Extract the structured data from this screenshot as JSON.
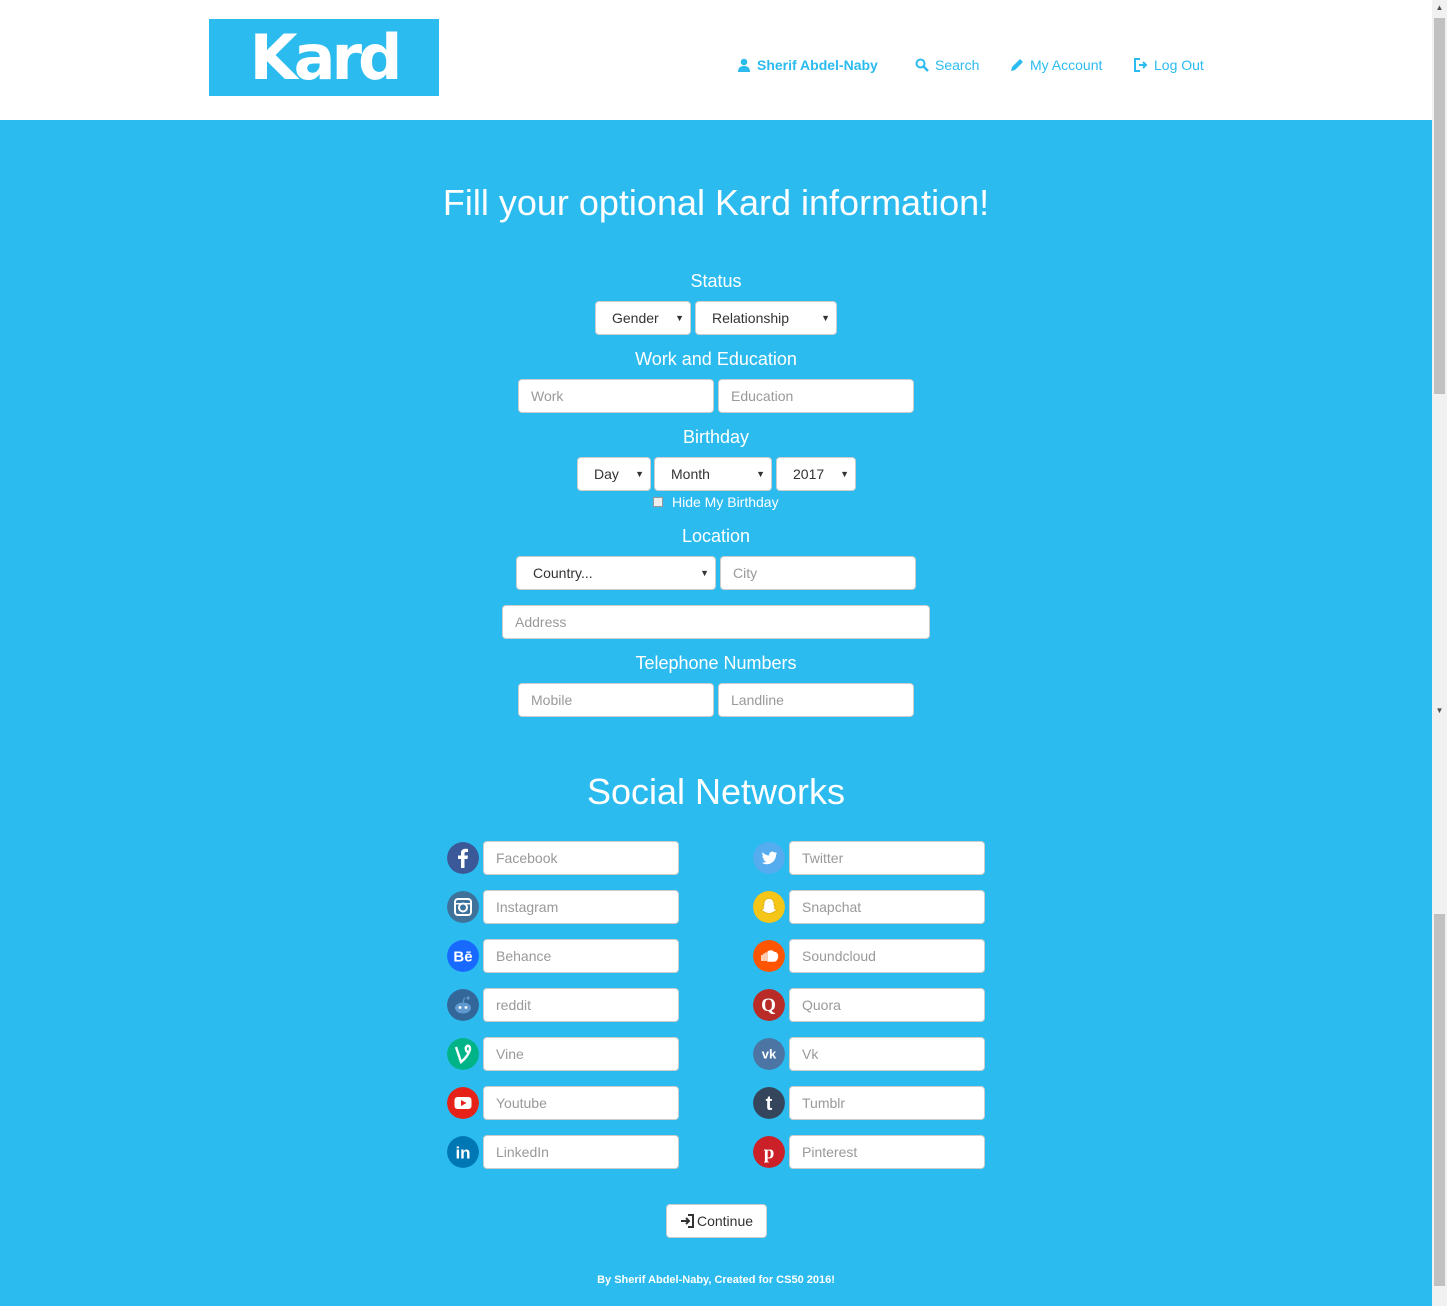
{
  "header": {
    "logo_text": "Kard",
    "nav": {
      "user_name": "Sherif Abdel-Naby",
      "search": "Search",
      "my_account": "My Account",
      "log_out": "Log Out"
    }
  },
  "page": {
    "title": "Fill your optional Kard information!",
    "status": {
      "heading": "Status",
      "gender_value": "Gender",
      "relationship_value": "Relationship"
    },
    "work_education": {
      "heading": "Work and Education",
      "work_placeholder": "Work",
      "education_placeholder": "Education"
    },
    "birthday": {
      "heading": "Birthday",
      "day_value": "Day",
      "month_value": "Month",
      "year_value": "2017",
      "hide_label": "Hide My Birthday",
      "hide_checked": false
    },
    "location": {
      "heading": "Location",
      "country_value": "Country...",
      "city_placeholder": "City",
      "address_placeholder": "Address"
    },
    "telephone": {
      "heading": "Telephone Numbers",
      "mobile_placeholder": "Mobile",
      "landline_placeholder": "Landline"
    },
    "social": {
      "heading": "Social Networks",
      "left": [
        {
          "name": "Facebook",
          "icon": "facebook-icon",
          "color": "#3b5998"
        },
        {
          "name": "Instagram",
          "icon": "instagram-icon",
          "color": "#3f729b"
        },
        {
          "name": "Behance",
          "icon": "behance-icon",
          "color": "#1769ff"
        },
        {
          "name": "reddit",
          "icon": "reddit-icon",
          "color": "#336699"
        },
        {
          "name": "Vine",
          "icon": "vine-icon",
          "color": "#00b488"
        },
        {
          "name": "Youtube",
          "icon": "youtube-icon",
          "color": "#e62117"
        },
        {
          "name": "LinkedIn",
          "icon": "linkedin-icon",
          "color": "#0077b5"
        }
      ],
      "right": [
        {
          "name": "Twitter",
          "icon": "twitter-icon",
          "color": "#55acee"
        },
        {
          "name": "Snapchat",
          "icon": "snapchat-icon",
          "color": "#fffc00"
        },
        {
          "name": "Soundcloud",
          "icon": "soundcloud-icon",
          "color": "#ff5500"
        },
        {
          "name": "Quora",
          "icon": "quora-icon",
          "color": "#b92b27"
        },
        {
          "name": "Vk",
          "icon": "vk-icon",
          "color": "#4c75a3"
        },
        {
          "name": "Tumblr",
          "icon": "tumblr-icon",
          "color": "#35465c"
        },
        {
          "name": "Pinterest",
          "icon": "pinterest-icon",
          "color": "#cb2027"
        }
      ]
    },
    "continue_label": "Continue",
    "footer": "By Sherif Abdel-Naby, Created for CS50 2016!"
  },
  "colors": {
    "brand": "#2bbbef",
    "white": "#ffffff"
  }
}
